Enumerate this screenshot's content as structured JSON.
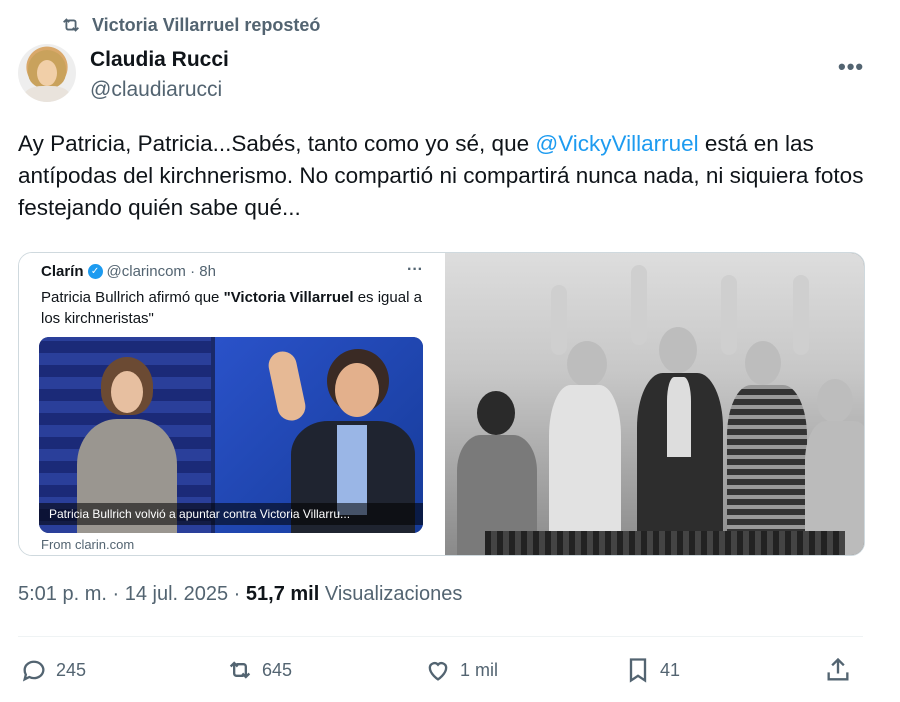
{
  "repost": {
    "icon": "repost-icon",
    "text": "Victoria Villarruel reposteó"
  },
  "author": {
    "name": "Claudia Rucci",
    "handle": "@claudiarucci",
    "avatar": "avatar"
  },
  "more_icon": "more-icon",
  "tweet": {
    "text_before": "Ay Patricia, Patricia...Sabés, tanto como yo sé, que ",
    "mention": "@VickyVillarruel",
    "text_after": " está en las antípodas del kirchnerismo. No compartió ni compartirá nunca nada, ni siquiera fotos festejando quién sabe qué..."
  },
  "embedded_card": {
    "source_name": "Clarín",
    "verified_icon": "verified-badge-icon",
    "handle_time": "@clarincom · 8h",
    "headline_before": "Patricia Bullrich afirmó que ",
    "headline_bold": "\"Victoria Villarruel",
    "headline_after": " es igual a los kirchneristas\"",
    "image_caption": "Patricia Bullrich volvió a apuntar contra Victoria Villarru...",
    "from": "From clarin.com"
  },
  "meta": {
    "time": "5:01 p. m. · 14 jul. 2025 · ",
    "views_count": "51,7 mil",
    "views_label": " Visualizaciones"
  },
  "actions": {
    "reply": {
      "icon": "reply-icon",
      "count": "245"
    },
    "repost": {
      "icon": "repost-icon",
      "count": "645"
    },
    "like": {
      "icon": "like-icon",
      "count": "1 mil"
    },
    "bookmark": {
      "icon": "bookmark-icon",
      "count": "41"
    },
    "share": {
      "icon": "share-icon"
    }
  },
  "colors": {
    "mention": "#1d9bf0",
    "secondary": "#536471",
    "text": "#0f1419"
  }
}
